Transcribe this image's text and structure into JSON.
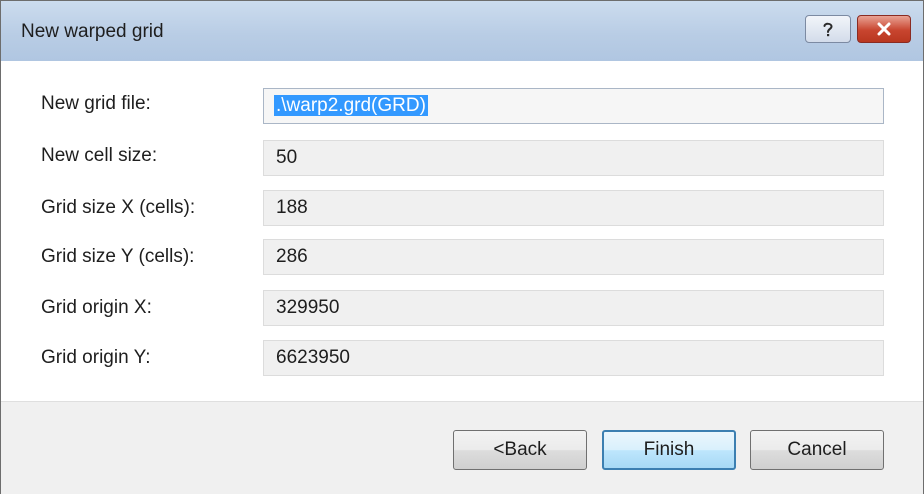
{
  "window": {
    "title": "New warped grid",
    "controls": [
      {
        "name": "help",
        "icon": "question-mark-icon"
      },
      {
        "name": "close",
        "icon": "close-x-icon"
      }
    ]
  },
  "form": {
    "fields": [
      {
        "label": "New grid file:",
        "value": ".\\warp2.grd(GRD)",
        "editable": true,
        "selected": true
      },
      {
        "label": "New cell size:",
        "value": "50",
        "editable": false
      },
      {
        "label": "Grid size X (cells):",
        "value": "188",
        "editable": false
      },
      {
        "label": "Grid size Y (cells):",
        "value": "286",
        "editable": false
      },
      {
        "label": "Grid origin X:",
        "value": "329950",
        "editable": false
      },
      {
        "label": "Grid origin Y:",
        "value": "6623950",
        "editable": false
      }
    ]
  },
  "buttons": {
    "back": "<Back",
    "finish": "Finish",
    "cancel": "Cancel"
  },
  "colors": {
    "selection": "#3399ff",
    "close_button": "#c8452f",
    "default_button_border": "#3c7fb1"
  }
}
